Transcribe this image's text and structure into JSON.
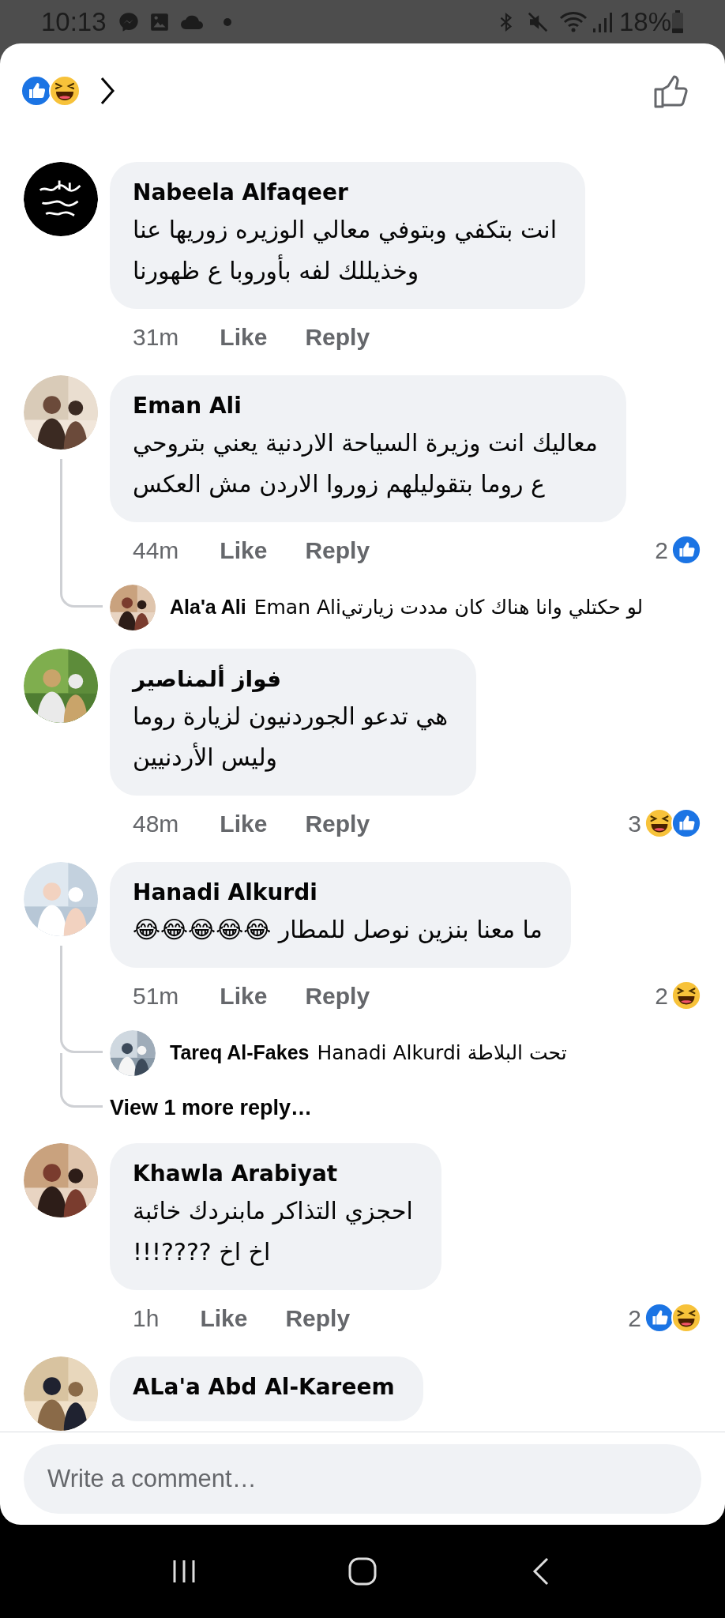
{
  "status_bar": {
    "time": "10:13",
    "battery": "18%"
  },
  "header": {
    "reactions": [
      {
        "kind": "like"
      },
      {
        "kind": "haha"
      }
    ]
  },
  "comments": [
    {
      "author": "Nabeela Alfaqeer",
      "text": "انت بتكفي وبتوفي معالي  الوزيره زوريها عنا\nوخذيللك لفه بأوروبا ع ظهورنا",
      "time": "31m",
      "like": "Like",
      "reply": "Reply"
    },
    {
      "author": "Eman Ali",
      "text": "معاليك انت وزيرة السياحة الاردنية يعني بتروحي\nع روما بتقوليلهم زوروا الاردن مش العكس",
      "time": "44m",
      "like": "Like",
      "reply": "Reply",
      "reaction_count": "2",
      "reactions": [
        {
          "kind": "like"
        }
      ],
      "replies": [
        {
          "author": "Ala'a Ali",
          "text": "Eman Aliلو حكتلي وانا هناك كان مددت زيارتي"
        }
      ]
    },
    {
      "author": "فواز ألمناصير",
      "text": "هي تدعو الجوردنيون لزيارة روما \nوليس الأردنيين",
      "time": "48m",
      "like": "Like",
      "reply": "Reply",
      "reaction_count": "3",
      "reactions": [
        {
          "kind": "haha"
        },
        {
          "kind": "like"
        }
      ]
    },
    {
      "author": "Hanadi Alkurdi",
      "text": "ما معنا بنزين نوصل للمطار 😂😂😂😂😂",
      "time": "51m",
      "like": "Like",
      "reply": "Reply",
      "reaction_count": "2",
      "reactions": [
        {
          "kind": "haha"
        }
      ],
      "replies": [
        {
          "author": "Tareq Al-Fakes",
          "text": "Hanadi Alkurdi تحت البلاطة"
        }
      ],
      "more_replies": "View 1 more reply…"
    },
    {
      "author": "Khawla Arabiyat",
      "text": "احجزي التذاكر مابنردك خائبة\nاخ اخ  ????!!!",
      "time": "1h",
      "like": "Like",
      "reply": "Reply",
      "reaction_count": "2",
      "reactions": [
        {
          "kind": "like"
        },
        {
          "kind": "haha"
        }
      ]
    },
    {
      "author": "ALa'a Abd Al-Kareem"
    }
  ],
  "composer": {
    "placeholder": "Write a comment…"
  }
}
